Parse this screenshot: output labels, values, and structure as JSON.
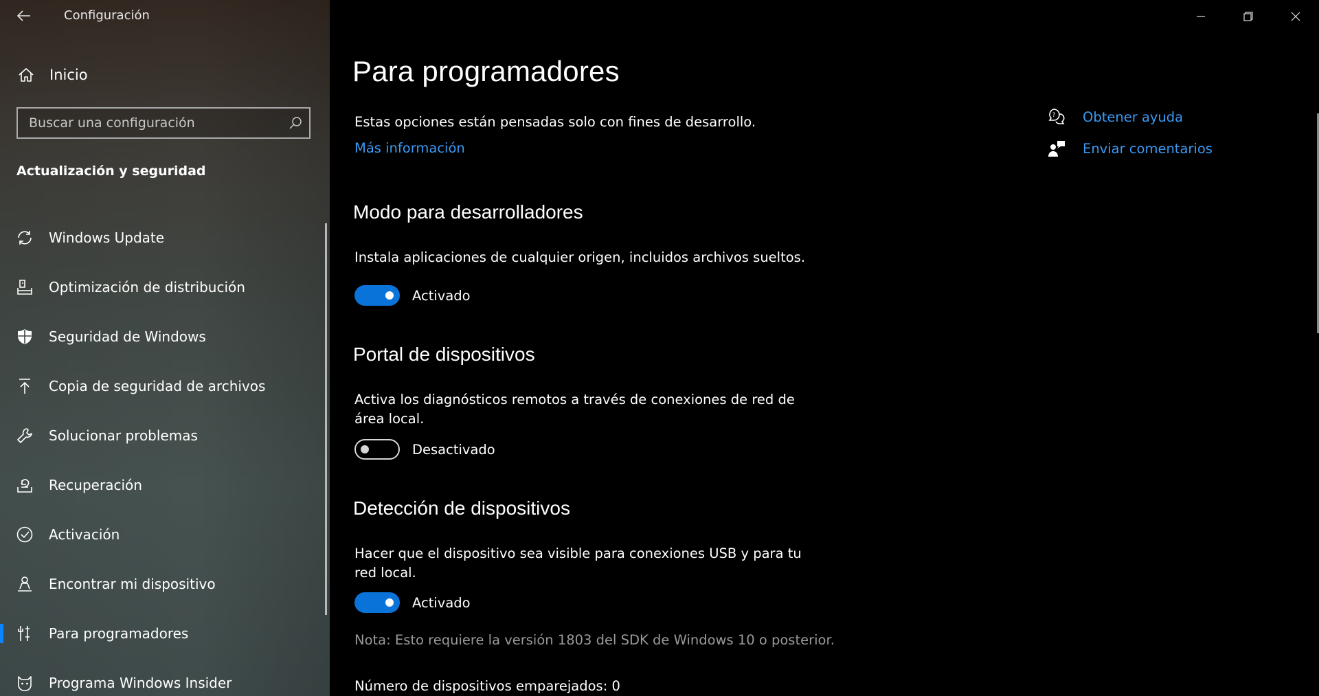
{
  "app": {
    "title": "Configuración"
  },
  "sidebar": {
    "home_label": "Inicio",
    "search_placeholder": "Buscar una configuración",
    "section_heading": "Actualización y seguridad",
    "items": [
      {
        "label": "Windows Update",
        "icon": "refresh-icon"
      },
      {
        "label": "Optimización de distribución",
        "icon": "delivery-optimization-icon"
      },
      {
        "label": "Seguridad de Windows",
        "icon": "shield-icon"
      },
      {
        "label": "Copia de seguridad de archivos",
        "icon": "backup-arrow-icon"
      },
      {
        "label": "Solucionar problemas",
        "icon": "wrench-icon"
      },
      {
        "label": "Recuperación",
        "icon": "recovery-icon"
      },
      {
        "label": "Activación",
        "icon": "checkmark-circle-icon"
      },
      {
        "label": "Encontrar mi dispositivo",
        "icon": "person-location-icon"
      },
      {
        "label": "Para programadores",
        "icon": "developer-tools-icon",
        "selected": true
      },
      {
        "label": "Programa Windows Insider",
        "icon": "insider-cat-icon"
      }
    ]
  },
  "main": {
    "page_title": "Para programadores",
    "intro": "Estas opciones están pensadas solo con fines de desarrollo.",
    "more_info_link": "Más información",
    "sections": {
      "dev_mode": {
        "heading": "Modo para desarrolladores",
        "description": "Instala aplicaciones de cualquier origen, incluidos archivos sueltos.",
        "toggle_state": "on",
        "toggle_label": "Activado"
      },
      "device_portal": {
        "heading": "Portal de dispositivos",
        "description": "Activa los diagnósticos remotos a través de conexiones de red de área local.",
        "toggle_state": "off",
        "toggle_label": "Desactivado"
      },
      "device_discovery": {
        "heading": "Detección de dispositivos",
        "description": "Hacer que el dispositivo sea visible para conexiones USB y para tu red local.",
        "toggle_state": "on",
        "toggle_label": "Activado",
        "note": "Nota: Esto requiere la versión 1803 del SDK de Windows 10 o posterior.",
        "paired_devices": "Número de dispositivos emparejados: 0"
      }
    },
    "help": {
      "get_help": "Obtener ayuda",
      "send_feedback": "Enviar comentarios"
    }
  },
  "colors": {
    "accent": "#0a73d9",
    "link": "#3a9af5",
    "background": "#000000"
  }
}
